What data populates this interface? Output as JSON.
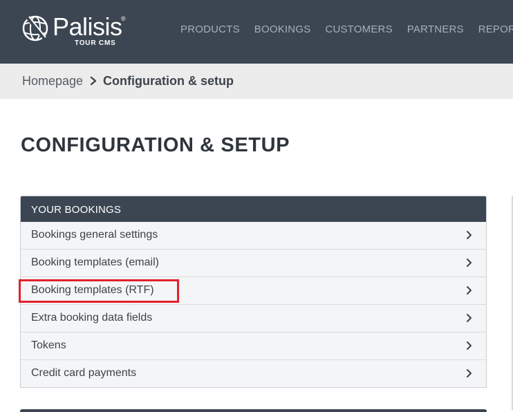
{
  "logo": {
    "name": "Palisis",
    "registered": "®",
    "subtitle": "TOUR CMS"
  },
  "nav": {
    "items": [
      "PRODUCTS",
      "BOOKINGS",
      "CUSTOMERS",
      "PARTNERS",
      "REPORTS"
    ]
  },
  "breadcrumb": {
    "home": "Homepage",
    "current": "Configuration & setup"
  },
  "page_title": "CONFIGURATION & SETUP",
  "panel": {
    "heading": "YOUR BOOKINGS",
    "items": [
      "Bookings general settings",
      "Booking templates (email)",
      "Booking templates (RTF)",
      "Extra booking data fields",
      "Tokens",
      "Credit card payments"
    ]
  },
  "colors": {
    "header_bg": "#3b4652",
    "highlight": "#e3202a",
    "breadcrumb_bg": "#ececec"
  },
  "icons": {
    "logo_mark": "globe-icon",
    "row_chevron": "chevron-right-icon",
    "breadcrumb_separator": "chevron-right-icon"
  }
}
